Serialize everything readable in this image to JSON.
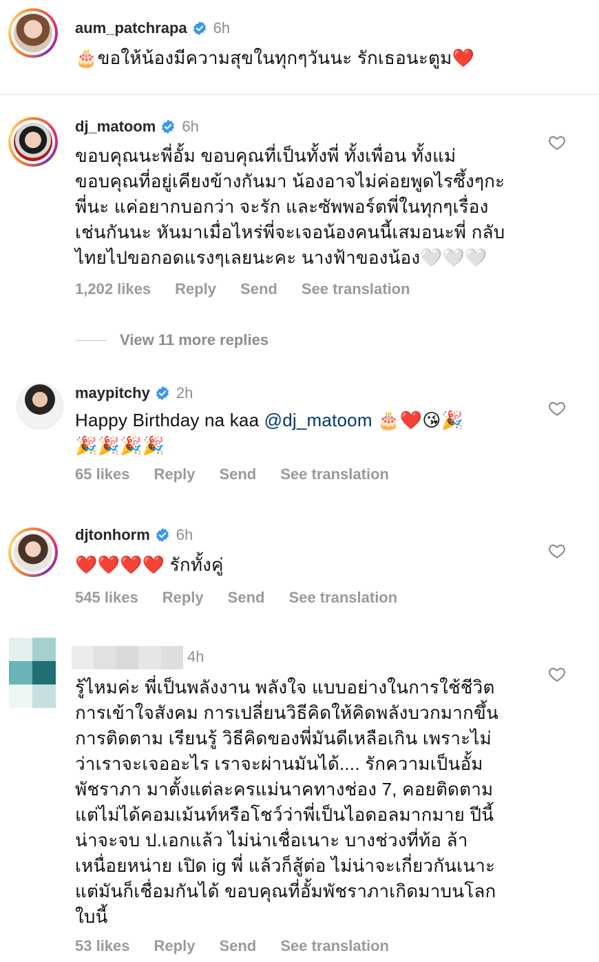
{
  "comments": [
    {
      "username": "aum_patchrapa",
      "time": "6h",
      "verified": true,
      "text": "🎂ขอให้น้องมีความสุขในทุกๆวันนะ รักเธอนะตูม❤️"
    },
    {
      "username": "dj_matoom",
      "time": "6h",
      "verified": true,
      "text": "ขอบคุณนะพี่อั้ม ขอบคุณที่เป็นทั้งพี่ ทั้งเพื่อน ทั้งแม่\nขอบคุณที่อยู่เคียงข้างกันมา น้องอาจไม่ค่อยพูดไรซึ้งๆกะ\nพี่นะ แค่อยากบอกว่า จะรัก และซัพพอร์ตพี่ในทุกๆเรื่อง\nเช่นกันนะ หันมาเมื่อไหร่พี่จะเจอน้องคนนี้เสมอนะพี่ กลับ\nไทยไปขอกอดแรงๆเลยนะคะ นางฟ้าของน้อง🤍🤍🤍",
      "likes": "1,202 likes"
    },
    {
      "username": "maypitchy",
      "time": "2h",
      "verified": true,
      "text_before": "Happy Birthday na kaa ",
      "mention": "@dj_matoom",
      "text_after": " 🎂❤️😘🎉\n🎉🎉🎉🎉",
      "likes": "65 likes"
    },
    {
      "username": "djtonhorm",
      "time": "6h",
      "verified": true,
      "text": "❤️❤️❤️❤️ รักทั้งคู่",
      "likes": "545 likes"
    },
    {
      "username": "",
      "time": "4h",
      "verified": false,
      "text": "รู้ไหมค่ะ พี่เป็นพลังงาน พลังใจ แบบอย่างในการใช้ชีวิต\nการเข้าใจสังคม การเปลี่ยนวิธีคิดให้คิดพลังบวกมากขึ้น\nการติดตาม เรียนรู้ วิธีคิดของพี่มันดีเหลือเกิน เพราะไม่\nว่าเราจะเจออะไร เราจะผ่านมันได้.... รักความเป็นอั้ม\nพัชราภา มาตั้งแต่ละครแม่นาคทางช่อง 7, คอยติดตาม\nแต่ไม่ได้คอมเม้นท์หรือโชว์ว่าพี่เป็นไอดอลมากมาย ปีนี้\nน่าจะจบ ป.เอกแล้ว ไม่น่าเชื่อเนาะ บางช่วงที่ท้อ ล้า\nเหนื่อยหน่าย เปิด ig พี่ แล้วก็สู้ต่อ ไม่น่าจะเกี่ยวกันเนาะ\nแต่มันก็เชื่อมกันได้ ขอบคุณที่อั้มพัชราภาเกิดมาบนโลก\nใบนี้",
      "likes": "53 likes"
    }
  ],
  "actions": {
    "reply": "Reply",
    "send": "Send",
    "see_translation": "See translation"
  },
  "view_more_replies": "View 11 more replies",
  "colors": {
    "verified": "#3897f0",
    "mention": "#00376b",
    "muted": "#8e8e8e"
  }
}
